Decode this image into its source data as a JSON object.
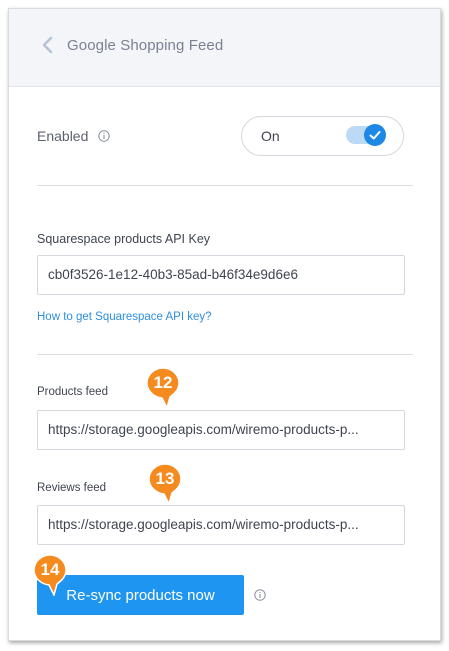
{
  "header": {
    "title": "Google Shopping Feed",
    "back_icon": "chevron-left-icon"
  },
  "enabled": {
    "label": "Enabled",
    "info_icon": "info-circle-icon",
    "toggle_label": "On",
    "toggle_checked": true
  },
  "api_key": {
    "label": "Squarespace products API Key",
    "value": "cb0f3526-1e12-40b3-85ad-b46f34e9d6e6",
    "help_link": "How to get Squarespace API key?"
  },
  "products_feed": {
    "label": "Products feed",
    "value": "https://storage.googleapis.com/wiremo-products-p..."
  },
  "reviews_feed": {
    "label": "Reviews feed",
    "value": "https://storage.googleapis.com/wiremo-products-p..."
  },
  "resync": {
    "label": "Re-sync products now",
    "info_icon": "info-circle-icon"
  },
  "callouts": [
    "12",
    "13",
    "14"
  ],
  "colors": {
    "accent": "#1e95f0",
    "callout": "#f58a1f",
    "link": "#2d8fe0"
  }
}
